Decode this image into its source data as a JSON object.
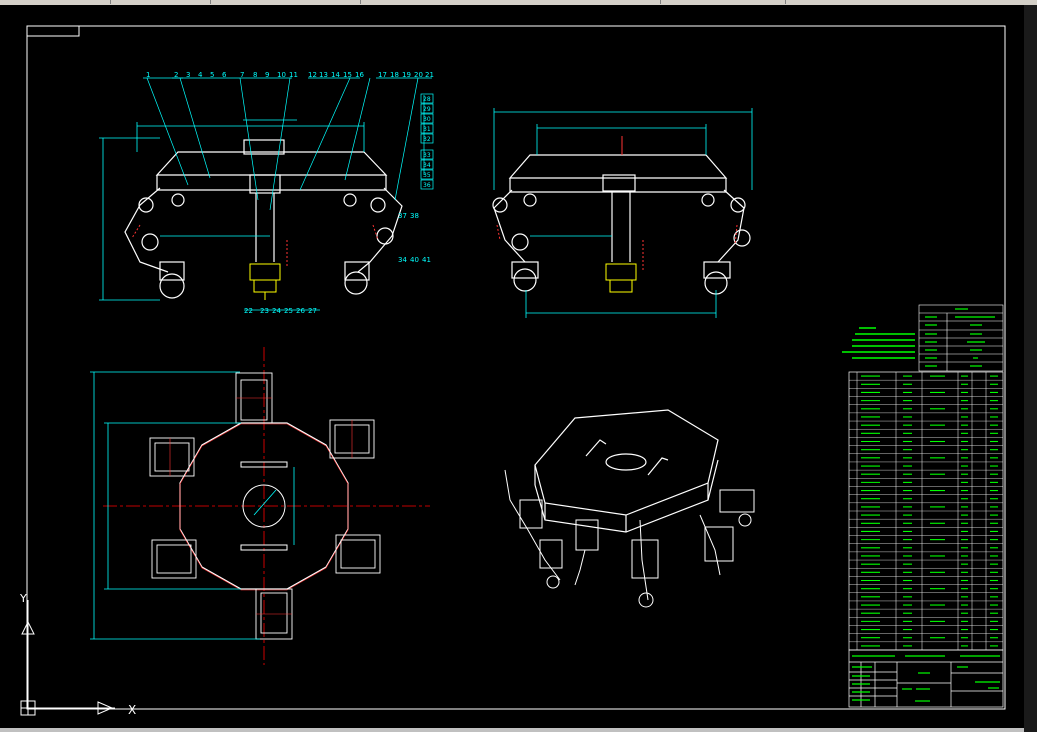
{
  "window": {
    "menu_strip": [
      "",
      "",
      "",
      "",
      ""
    ]
  },
  "drawing": {
    "colors": {
      "background": "#000000",
      "frame": "#ffffff",
      "geometry": "#ffffff",
      "dimension": "#00ffff",
      "leader": "#00ff00",
      "center": "#ff0000",
      "part": "#ffff00",
      "accent": "#ff3333"
    },
    "balloons_top": [
      "1",
      "2",
      "3",
      "4",
      "5",
      "6",
      "7",
      "8",
      "9",
      "10",
      "11",
      "12",
      "13",
      "14",
      "15",
      "16",
      "17",
      "18",
      "19",
      "20",
      "21"
    ],
    "balloons_bottom": [
      "22",
      "23",
      "24",
      "25",
      "26",
      "27"
    ],
    "balloons_right": [
      "37",
      "38",
      "34",
      "40",
      "41"
    ],
    "balloons_stack": [
      "28",
      "29",
      "30",
      "31",
      "32",
      "33",
      "34",
      "35",
      "36"
    ],
    "ucs": {
      "x_label": "X",
      "y_label": "Y"
    }
  }
}
